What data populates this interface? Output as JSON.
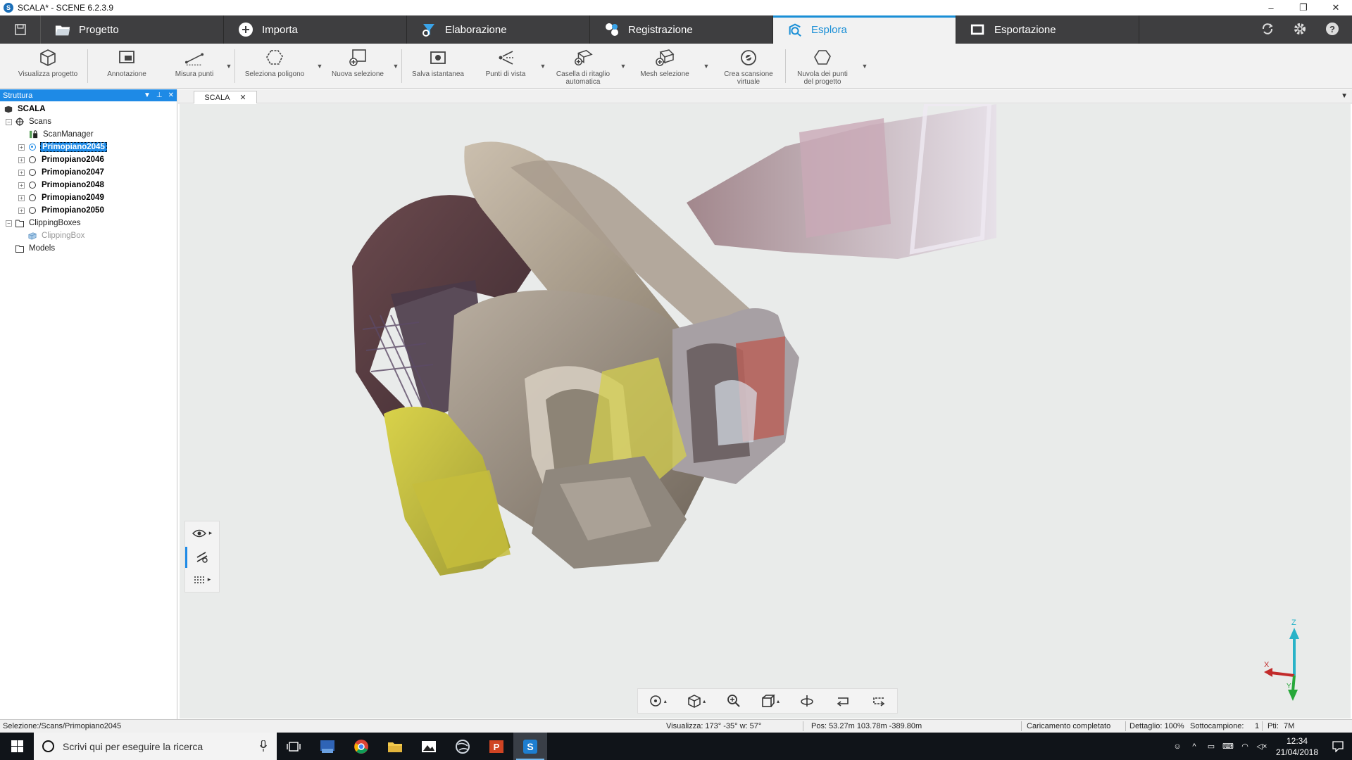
{
  "window": {
    "title": "SCALA* - SCENE 6.2.3.9",
    "minimize": "–",
    "restore": "❐",
    "close": "✕"
  },
  "tabs": [
    {
      "label": "Progetto",
      "icon": "folder-icon"
    },
    {
      "label": "Importa",
      "icon": "import-icon"
    },
    {
      "label": "Elaborazione",
      "icon": "processing-icon"
    },
    {
      "label": "Registrazione",
      "icon": "registration-icon"
    },
    {
      "label": "Esplora",
      "icon": "explore-icon",
      "active": true
    },
    {
      "label": "Esportazione",
      "icon": "export-icon"
    }
  ],
  "ribbon": {
    "view_project": "Visualizza progetto",
    "annotation": "Annotazione",
    "measure_points": "Misura punti",
    "select_polygon": "Seleziona poligono",
    "new_selection": "Nuova selezione",
    "save_snapshot": "Salva istantanea",
    "viewpoints": "Punti di vista",
    "auto_clipbox_line1": "Casella di ritaglio",
    "auto_clipbox_line2": "automatica",
    "mesh_selection": "Mesh selezione",
    "virtual_scan_line1": "Crea scansione",
    "virtual_scan_line2": "virtuale",
    "project_cloud_line1": "Nuvola dei punti",
    "project_cloud_line2": "del progetto"
  },
  "structure_panel": {
    "title": "Struttura",
    "root": "SCALA",
    "scans": "Scans",
    "scan_manager": "ScanManager",
    "scan_items": [
      "Primopiano2045",
      "Primopiano2046",
      "Primopiano2047",
      "Primopiano2048",
      "Primopiano2049",
      "Primopiano2050"
    ],
    "selected_scan": "Primopiano2045",
    "clipping_boxes": "ClippingBoxes",
    "clipping_box": "ClippingBox",
    "models": "Models"
  },
  "viewer": {
    "doc_tab": "SCALA",
    "axis_x": "X",
    "axis_y": "Y",
    "axis_z": "Z"
  },
  "status": {
    "selection": "Selezione:/Scans/Primopiano2045",
    "view": "Visualizza: 173° -35° w: 57°",
    "position": "Pos: 53.27m 103.78m -389.80m",
    "loading": "Caricamento completato",
    "detail": "Dettaglio: 100%",
    "subsample": "Sottocampione:",
    "subsample_value": "1",
    "points": "Pti:",
    "points_value": "7M"
  },
  "taskbar": {
    "search_placeholder": "Scrivi qui per eseguire la ricerca",
    "time": "12:34",
    "date": "21/04/2018"
  },
  "colors": {
    "accent": "#1e8ae6",
    "tabbar": "#3e3e40",
    "viewport_bg": "#e9ebea"
  }
}
